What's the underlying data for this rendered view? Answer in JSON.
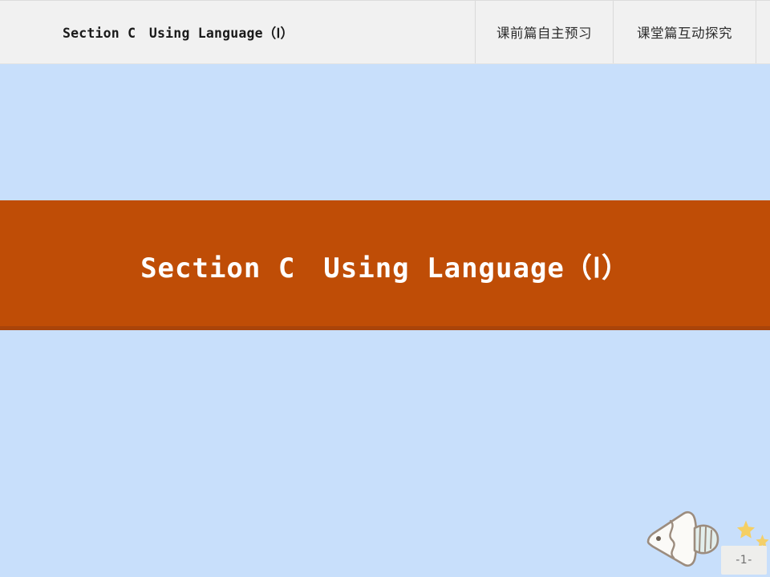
{
  "slide": {
    "background_color": "#c8dffb"
  },
  "header": {
    "title": "Section C　Using Language（Ⅰ）",
    "tabs": [
      {
        "label": "课前篇自主预习"
      },
      {
        "label": "课堂篇互动探究"
      }
    ]
  },
  "banner": {
    "title": "Section C　Using Language（Ⅰ）",
    "background_color": "#bf4d06",
    "text_color": "#ffffff"
  },
  "decoration": {
    "fish_icon": "fish-icon",
    "star_big_icon": "star-icon",
    "star_small_icon": "star-icon",
    "fish_color": "#fbfaf7",
    "fish_outline_color": "#9c8c7e",
    "fish_tail_color": "#bfdcd8",
    "star_color": "#f5cf63"
  },
  "footer": {
    "page_number": "-1-"
  }
}
